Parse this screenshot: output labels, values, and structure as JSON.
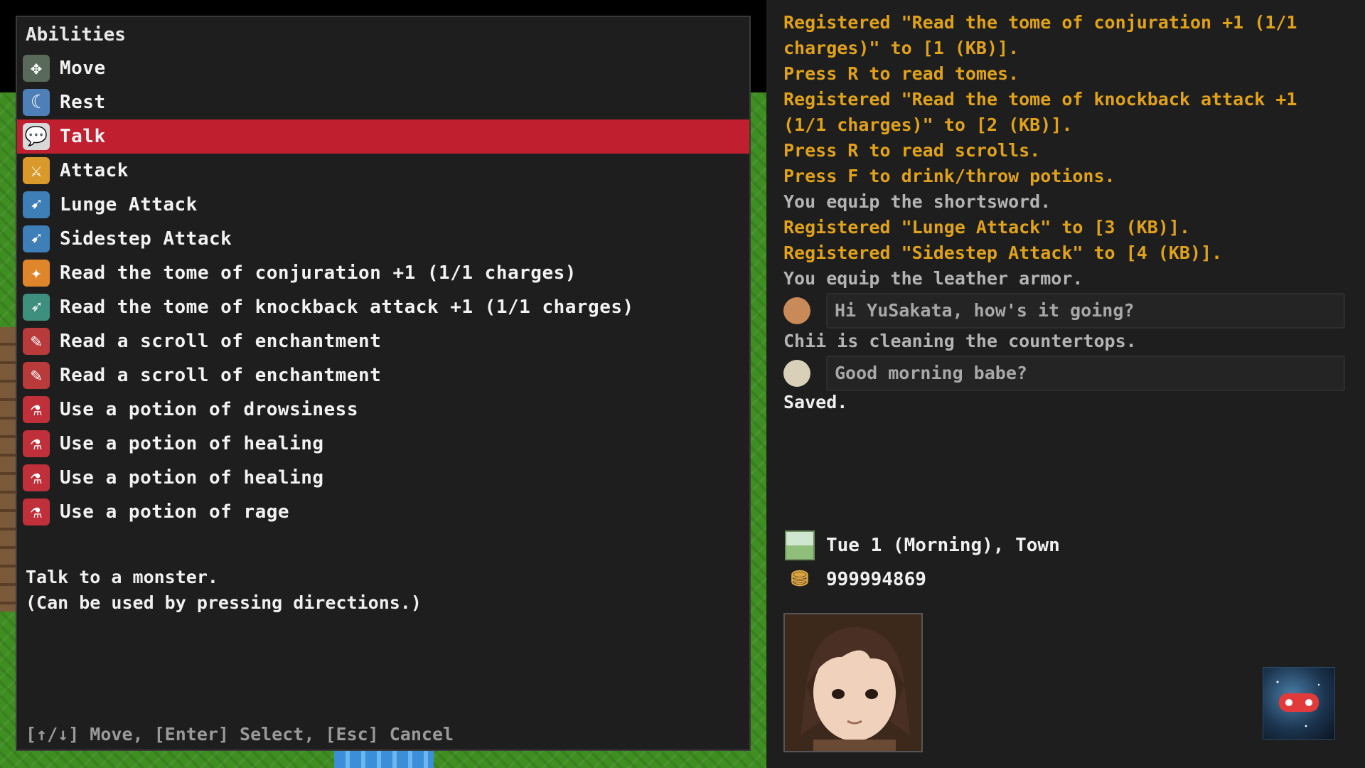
{
  "abilities": {
    "title": "Abilities",
    "items": [
      {
        "label": "Move",
        "icon": "move-icon",
        "glyph": "✥",
        "color": "#5a6a5a"
      },
      {
        "label": "Rest",
        "icon": "rest-icon",
        "glyph": "☾",
        "color": "#4f7fb8"
      },
      {
        "label": "Talk",
        "icon": "talk-icon",
        "glyph": "💬",
        "color": "#d8d8d8",
        "selected": true
      },
      {
        "label": "Attack",
        "icon": "attack-icon",
        "glyph": "⚔",
        "color": "#d99a2b"
      },
      {
        "label": "Lunge Attack",
        "icon": "lunge-attack-icon",
        "glyph": "➹",
        "color": "#3f7fb8"
      },
      {
        "label": "Sidestep Attack",
        "icon": "sidestep-attack-icon",
        "glyph": "➹",
        "color": "#3f7fb8"
      },
      {
        "label": "Read the tome of conjuration +1 (1/1 charges)",
        "icon": "tome-conjuration-icon",
        "glyph": "✦",
        "color": "#e0862a"
      },
      {
        "label": "Read the tome of knockback attack +1 (1/1 charges)",
        "icon": "tome-knockback-icon",
        "glyph": "➶",
        "color": "#3f8f7f"
      },
      {
        "label": "Read a scroll of enchantment",
        "icon": "scroll-icon",
        "glyph": "✎",
        "color": "#b83a3a"
      },
      {
        "label": "Read a scroll of enchantment",
        "icon": "scroll-icon",
        "glyph": "✎",
        "color": "#b83a3a"
      },
      {
        "label": "Use a potion of drowsiness",
        "icon": "potion-icon",
        "glyph": "⚗",
        "color": "#c0303a"
      },
      {
        "label": "Use a potion of healing",
        "icon": "potion-icon",
        "glyph": "⚗",
        "color": "#c0303a"
      },
      {
        "label": "Use a potion of healing",
        "icon": "potion-icon",
        "glyph": "⚗",
        "color": "#c0303a"
      },
      {
        "label": "Use a potion of rage",
        "icon": "potion-icon",
        "glyph": "⚗",
        "color": "#c0303a"
      }
    ],
    "description": [
      "Talk to a monster.",
      "(Can be used by pressing directions.)"
    ],
    "controls": "[↑/↓] Move, [Enter] Select, [Esc] Cancel"
  },
  "log": [
    {
      "type": "sys",
      "text": "Registered \"Read the tome of conjuration +1 (1/1"
    },
    {
      "type": "sys",
      "text": "charges)\" to [1 (KB)]."
    },
    {
      "type": "sys",
      "text": "Press R to read tomes."
    },
    {
      "type": "sys",
      "text": "Registered \"Read the tome of knockback attack +1"
    },
    {
      "type": "sys",
      "text": "(1/1 charges)\" to [2 (KB)]."
    },
    {
      "type": "sys",
      "text": "Press R to read scrolls."
    },
    {
      "type": "sys",
      "text": "Press F to drink/throw potions."
    },
    {
      "type": "neutral",
      "text": "You equip the shortsword."
    },
    {
      "type": "sys",
      "text": "Registered \"Lunge Attack\" to [3 (KB)]."
    },
    {
      "type": "sys",
      "text": "Registered \"Sidestep Attack\" to [4 (KB)]."
    },
    {
      "type": "neutral",
      "text": "You equip the leather armor."
    },
    {
      "type": "speech",
      "text": "Hi YuSakata, how's it going?",
      "avatar_color": "#c98a5a"
    },
    {
      "type": "neutral",
      "text": "Chii is cleaning the countertops."
    },
    {
      "type": "speech",
      "text": "Good morning babe?",
      "avatar_color": "#d8d0b8"
    },
    {
      "type": "saved",
      "text": "Saved."
    }
  ],
  "status": {
    "date": "Tue 1 (Morning), Town",
    "gold": "999994869"
  },
  "colors": {
    "selected_row": "#bf1f2f",
    "system_message": "#e0a21a",
    "neutral_message": "#b4b4b4"
  }
}
